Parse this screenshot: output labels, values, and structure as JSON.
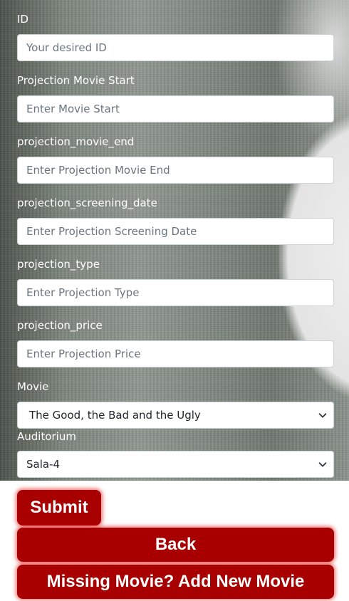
{
  "form": {
    "fields": [
      {
        "label": "ID",
        "placeholder": "Your desired ID"
      },
      {
        "label": "Projection Movie Start",
        "placeholder": "Enter Movie Start"
      },
      {
        "label": "projection_movie_end",
        "placeholder": "Enter Projection Movie End"
      },
      {
        "label": "projection_screening_date",
        "placeholder": "Enter Projection Screening Date"
      },
      {
        "label": "projection_type",
        "placeholder": "Enter Projection Type"
      },
      {
        "label": "projection_price",
        "placeholder": "Enter Projection Price"
      }
    ],
    "movie": {
      "label": "Movie",
      "selected": "The Good, the Bad and the Ugly"
    },
    "auditorium": {
      "label": "Auditorium",
      "selected": "Sala-4"
    }
  },
  "buttons": {
    "submit": "Submit",
    "back": "Back",
    "add_movie": "Missing Movie? Add New Movie"
  },
  "colors": {
    "button_bg": "#a80000",
    "label_text": "#ffffff"
  }
}
